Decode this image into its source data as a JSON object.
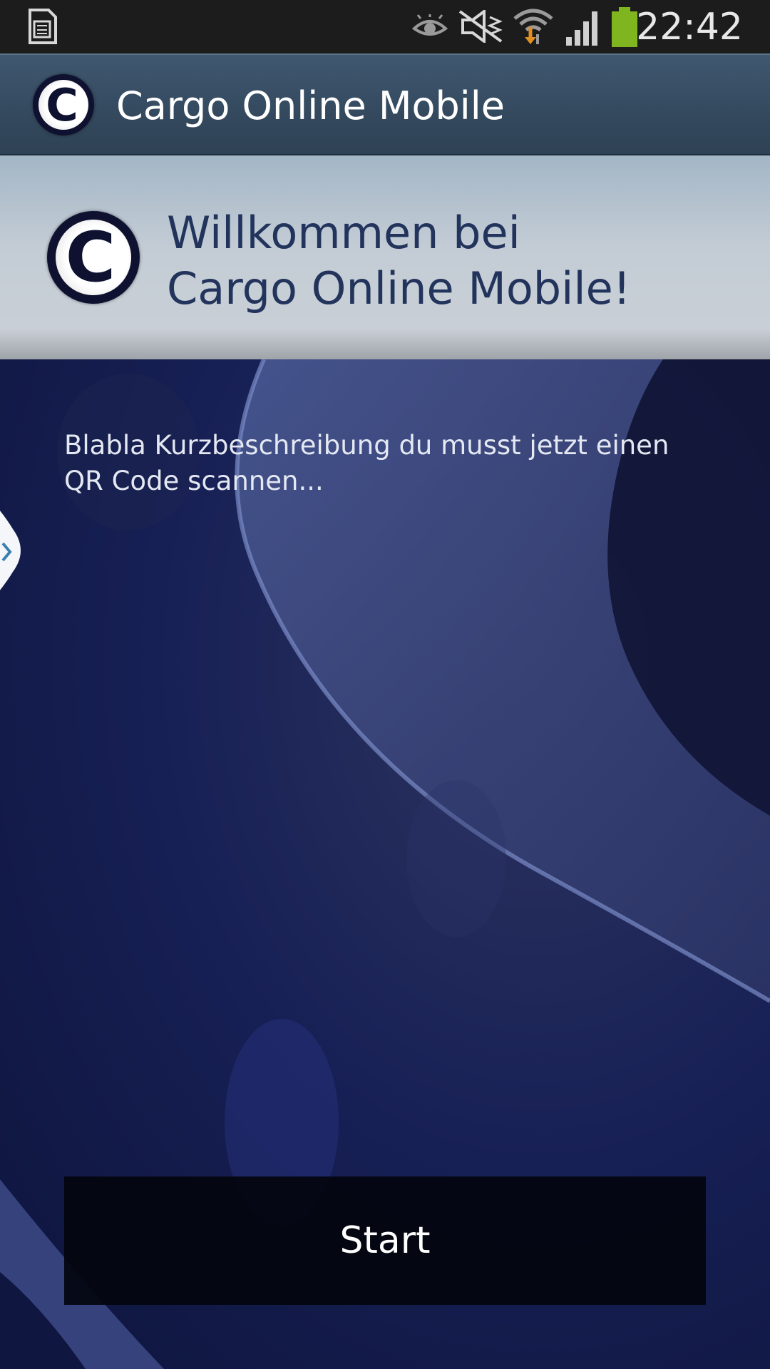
{
  "status_bar": {
    "time": "22:42",
    "icons": [
      "sim-card-icon",
      "eye-icon",
      "mute-icon",
      "wifi-download-icon",
      "signal-icon",
      "battery-icon"
    ],
    "battery_color": "#7fb51e"
  },
  "action_bar": {
    "title": "Cargo Online Mobile",
    "logo_icon": "copyright-logo-icon"
  },
  "welcome": {
    "line1": "Willkommen bei",
    "line2": "Cargo Online Mobile!"
  },
  "main": {
    "description": "Blabla Kurzbeschreibung du musst jetzt einen QR Code scannen...",
    "drawer_handle_icon": "chevron-right-icon",
    "start_label": "Start"
  },
  "colors": {
    "action_bar": "#34495e",
    "header_text": "#22335c",
    "background": "#151a3e"
  }
}
